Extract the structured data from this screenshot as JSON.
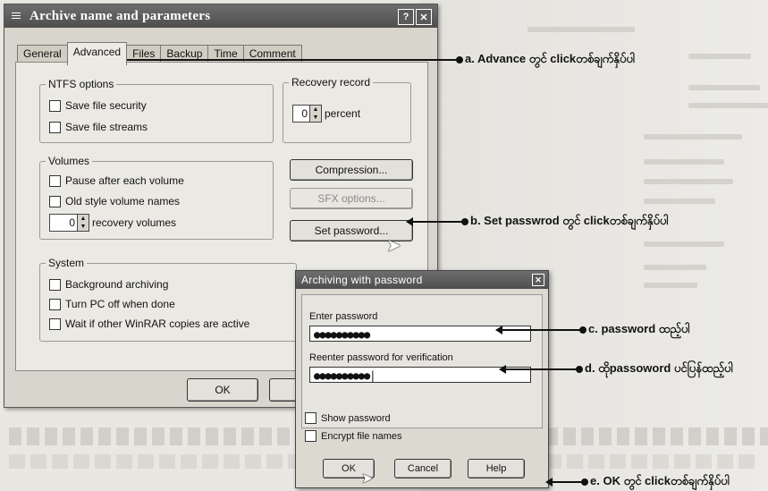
{
  "main_window": {
    "title": "Archive name and parameters",
    "tabs": [
      {
        "label": "General",
        "active": false
      },
      {
        "label": "Advanced",
        "active": true
      },
      {
        "label": "Files",
        "active": false
      },
      {
        "label": "Backup",
        "active": false
      },
      {
        "label": "Time",
        "active": false
      },
      {
        "label": "Comment",
        "active": false
      }
    ],
    "ntfs": {
      "title": "NTFS options",
      "save_security": "Save file security",
      "save_streams": "Save file streams"
    },
    "recovery": {
      "title": "Recovery record",
      "value": "0",
      "unit": "percent"
    },
    "volumes": {
      "title": "Volumes",
      "pause": "Pause after each volume",
      "old_style": "Old style volume names",
      "rec_value": "0",
      "rec_label": "recovery volumes"
    },
    "buttons": {
      "compression": "Compression...",
      "sfx": "SFX options...",
      "set_password": "Set password..."
    },
    "system": {
      "title": "System",
      "background": "Background archiving",
      "turn_off": "Turn PC off when done",
      "wait": "Wait if other WinRAR copies are active"
    },
    "ok": "OK"
  },
  "password_dialog": {
    "title": "Archiving with password",
    "enter_label": "Enter password",
    "enter_value": "●●●●●●●●●●",
    "reenter_label": "Reenter password for verification",
    "reenter_value": "●●●●●●●●●●|",
    "show_password": "Show password",
    "encrypt_names": "Encrypt file names",
    "ok": "OK",
    "cancel": "Cancel",
    "help": "Help"
  },
  "annotations": {
    "a": "a. Advance တွင် clickတစ်ချက်နှိပ်ပါ",
    "b": "b. Set passwrod တွင် clickတစ်ချက်နှိပ်ပါ",
    "c": "c. password ထည့်ပါ",
    "d": "d. ထိုpassoword ပင်ပြန်ထည့်ပါ",
    "e": "e. OK တွင် clickတစ်ချက်နှိပ်ပါ"
  }
}
